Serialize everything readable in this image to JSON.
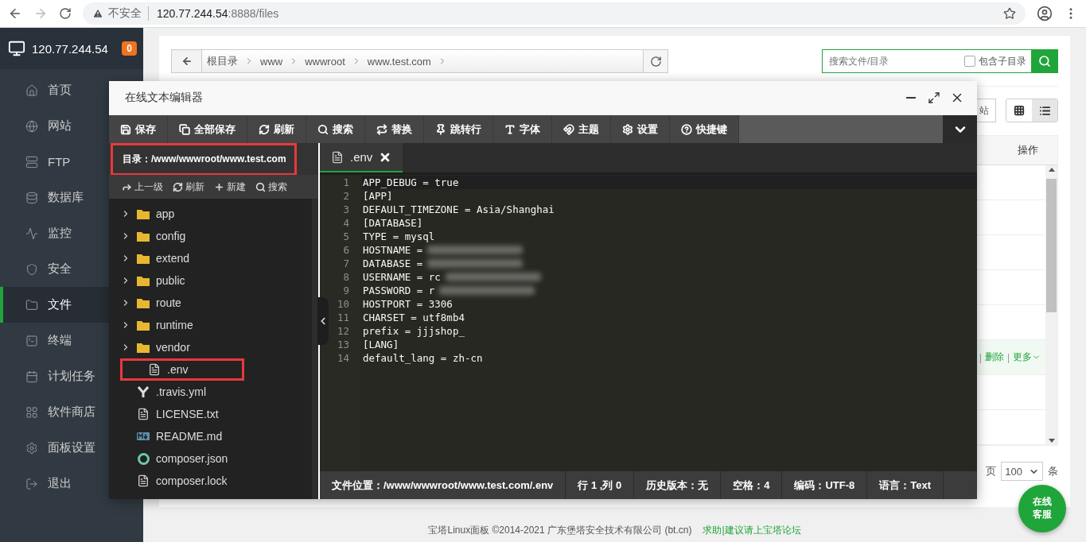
{
  "browser": {
    "security_label": "不安全",
    "url_host": "120.77.244.54",
    "url_rest": ":8888/files"
  },
  "sidebar": {
    "host": "120.77.244.54",
    "badge": "0",
    "items": [
      {
        "label": "首页",
        "selected": false
      },
      {
        "label": "网站",
        "selected": false
      },
      {
        "label": "FTP",
        "selected": false
      },
      {
        "label": "数据库",
        "selected": false
      },
      {
        "label": "监控",
        "selected": false
      },
      {
        "label": "安全",
        "selected": false
      },
      {
        "label": "文件",
        "selected": true
      },
      {
        "label": "终端",
        "selected": false
      },
      {
        "label": "计划任务",
        "selected": false
      },
      {
        "label": "软件商店",
        "selected": false
      },
      {
        "label": "面板设置",
        "selected": false
      },
      {
        "label": "退出",
        "selected": false
      }
    ]
  },
  "file_manager": {
    "breadcrumbs": [
      "根目录",
      "www",
      "wwwroot",
      "www.test.com"
    ],
    "search": {
      "placeholder": "搜索文件/目录",
      "include_subdirs": {
        "label": "包含子目录",
        "checked": false
      }
    },
    "partial_button": "站",
    "view_modes": [
      {
        "selected": false
      },
      {
        "selected": true
      }
    ],
    "table": {
      "column": "操作",
      "rows": [
        {
          "highlighted": false
        },
        {
          "highlighted": false
        },
        {
          "highlighted": false
        },
        {
          "highlighted": false
        },
        {
          "highlighted": false
        },
        {
          "highlighted": true,
          "separator": "|",
          "actions": [
            "删除",
            "更多"
          ]
        },
        {
          "highlighted": false
        },
        {
          "highlighted": false
        }
      ]
    },
    "pagination": {
      "label": "页",
      "per_page": "100",
      "unit": "条"
    }
  },
  "editor": {
    "title": "在线文本编辑器",
    "toolbar": [
      "保存",
      "全部保存",
      "刷新",
      "搜索",
      "替换",
      "跳转行",
      "字体",
      "主题",
      "设置",
      "快捷键"
    ],
    "directory": {
      "label": "目录：/www/wwwroot/www.test.com",
      "highlighted": true
    },
    "tree_toolbar": [
      "上一级",
      "刷新",
      "新建",
      "搜索"
    ],
    "tree": [
      {
        "name": "app",
        "kind": "folder",
        "highlighted": false
      },
      {
        "name": "config",
        "kind": "folder",
        "highlighted": false
      },
      {
        "name": "extend",
        "kind": "folder",
        "highlighted": false
      },
      {
        "name": "public",
        "kind": "folder",
        "highlighted": false
      },
      {
        "name": "route",
        "kind": "folder",
        "highlighted": false
      },
      {
        "name": "runtime",
        "kind": "folder",
        "highlighted": false
      },
      {
        "name": "vendor",
        "kind": "folder",
        "highlighted": false
      },
      {
        "name": ".env",
        "kind": "file",
        "highlighted": true
      },
      {
        "name": ".travis.yml",
        "kind": "yaml",
        "highlighted": false
      },
      {
        "name": "LICENSE.txt",
        "kind": "file",
        "highlighted": false
      },
      {
        "name": "README.md",
        "kind": "markdown",
        "highlighted": false
      },
      {
        "name": "composer.json",
        "kind": "composer",
        "highlighted": false
      },
      {
        "name": "composer.lock",
        "kind": "file",
        "highlighted": false
      }
    ],
    "tabs": [
      {
        "label": ".env",
        "selected": true
      }
    ],
    "lines": [
      {
        "number": "1",
        "text": "APP_DEBUG = true",
        "redacted": false
      },
      {
        "number": "2",
        "text": "[APP]",
        "redacted": false
      },
      {
        "number": "3",
        "text": "DEFAULT_TIMEZONE = Asia/Shanghai",
        "redacted": false
      },
      {
        "number": "4",
        "text": "[DATABASE]",
        "redacted": false
      },
      {
        "number": "5",
        "text": "TYPE = mysql",
        "redacted": false
      },
      {
        "number": "6",
        "text": "HOSTNAME =",
        "redacted": true
      },
      {
        "number": "7",
        "text": "DATABASE =",
        "redacted": true
      },
      {
        "number": "8",
        "text": "USERNAME = rc",
        "redacted": true
      },
      {
        "number": "9",
        "text": "PASSWORD = r",
        "redacted": true
      },
      {
        "number": "10",
        "text": "HOSTPORT = 3306",
        "redacted": false
      },
      {
        "number": "11",
        "text": "CHARSET = utf8mb4",
        "redacted": false
      },
      {
        "number": "12",
        "text": "prefix = jjjshop_",
        "redacted": false
      },
      {
        "number": "13",
        "text": "[LANG]",
        "redacted": false
      },
      {
        "number": "14",
        "text": "default_lang = zh-cn",
        "redacted": false
      }
    ],
    "status": [
      "文件位置：/www/wwwroot/www.test.com/.env",
      "行 1 ,列 0",
      "历史版本：无",
      "空格：4",
      "编码：UTF-8",
      "语言：Text"
    ]
  },
  "footer": {
    "text": "宝塔Linux面板 ©2014-2021 广东堡塔安全技术有限公司 (bt.cn)",
    "link": "求助|建议请上宝塔论坛"
  },
  "chat_button": "在线客服"
}
